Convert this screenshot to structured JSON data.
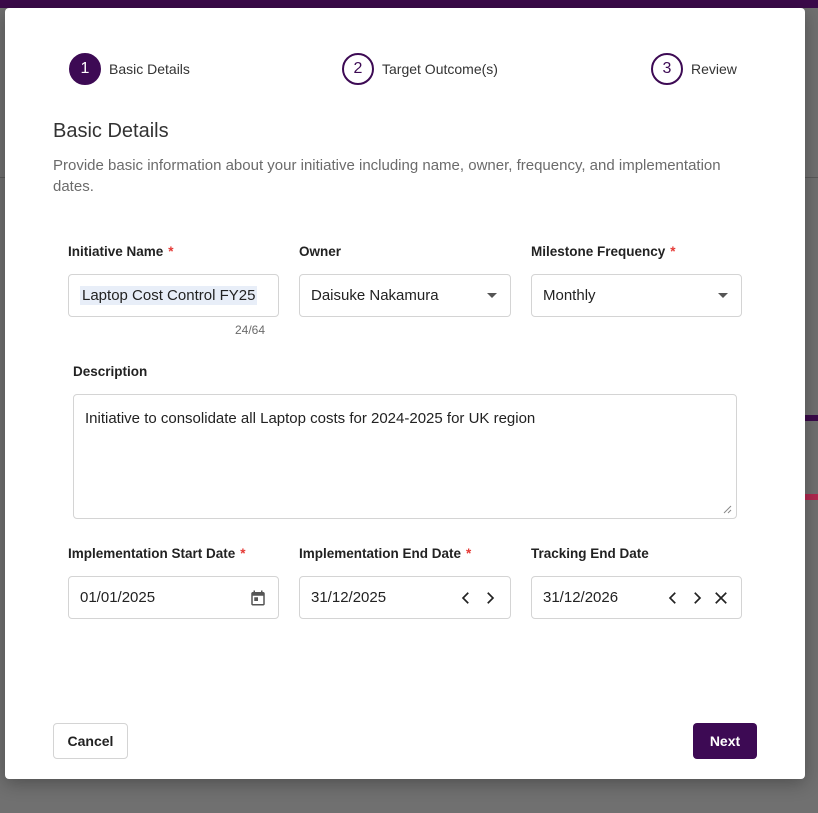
{
  "stepper": {
    "steps": [
      {
        "number": "1",
        "label": "Basic Details"
      },
      {
        "number": "2",
        "label": "Target Outcome(s)"
      },
      {
        "number": "3",
        "label": "Review"
      }
    ]
  },
  "header": {
    "title": "Basic Details",
    "subtitle": "Provide basic information about your initiative including name, owner, frequency, and implementation dates."
  },
  "form": {
    "initiative_name": {
      "label": "Initiative Name",
      "value": "Laptop Cost Control FY25",
      "counter": "24/64"
    },
    "owner": {
      "label": "Owner",
      "value": "Daisuke Nakamura"
    },
    "milestone_frequency": {
      "label": "Milestone Frequency",
      "value": "Monthly"
    },
    "description": {
      "label": "Description",
      "value": "Initiative to consolidate all Laptop costs for 2024-2025 for UK region"
    },
    "start_date": {
      "label": "Implementation Start Date",
      "value": "01/01/2025"
    },
    "end_date": {
      "label": "Implementation End Date",
      "value": "31/12/2025"
    },
    "tracking_end_date": {
      "label": "Tracking End Date",
      "value": "31/12/2026"
    },
    "required_marker": "*"
  },
  "footer": {
    "cancel_label": "Cancel",
    "next_label": "Next"
  },
  "colors": {
    "accent": "#3d0a54",
    "required": "#e53935"
  }
}
